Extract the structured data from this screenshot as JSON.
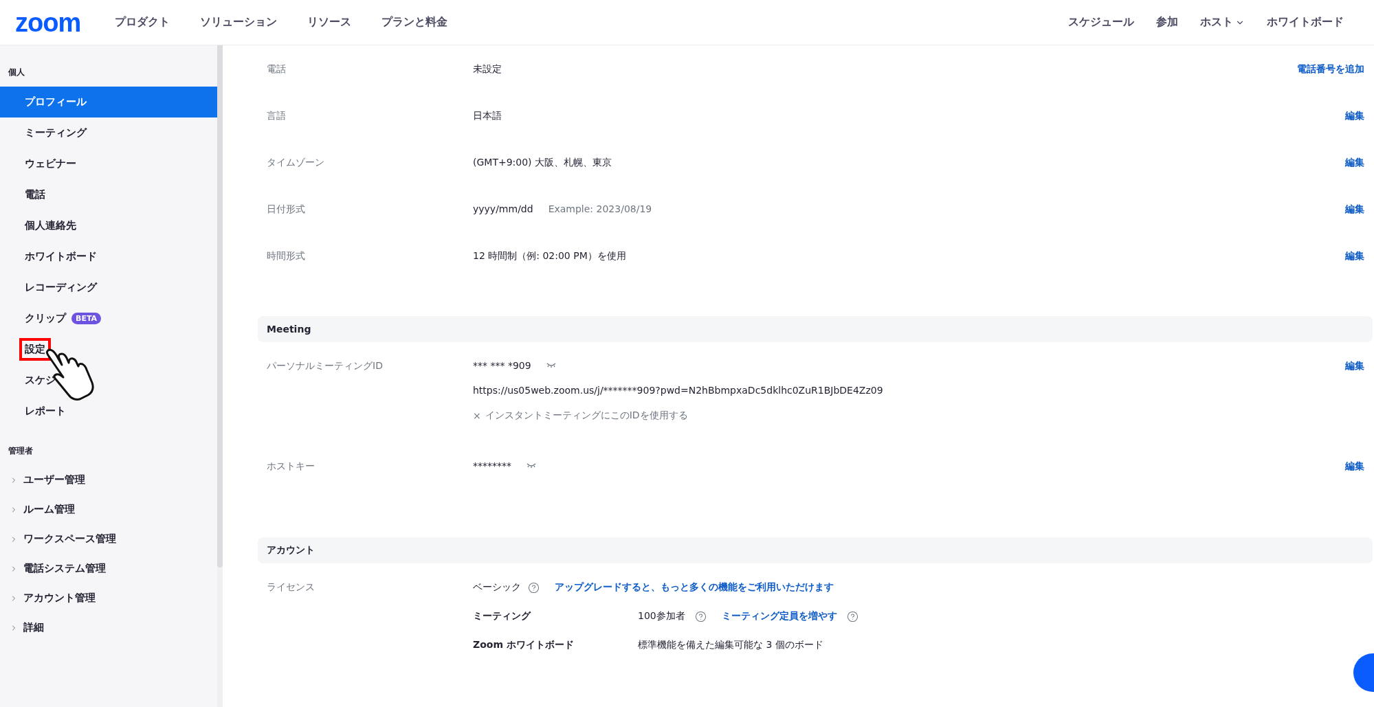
{
  "header": {
    "logo": "zoom",
    "nav_left": [
      {
        "label": "プロダクト"
      },
      {
        "label": "ソリューション"
      },
      {
        "label": "リソース"
      },
      {
        "label": "プランと料金"
      }
    ],
    "nav_right": [
      {
        "label": "スケジュール",
        "kind": "link"
      },
      {
        "label": "参加",
        "kind": "link"
      },
      {
        "label": "ホスト",
        "kind": "dropdown"
      },
      {
        "label": "ホワイトボード",
        "kind": "link"
      }
    ]
  },
  "sidebar": [
    {
      "heading": "個人",
      "items": [
        {
          "label": "プロフィール",
          "selected": true
        },
        {
          "label": "ミーティング",
          "selected": false
        },
        {
          "label": "ウェビナー",
          "selected": false
        },
        {
          "label": "電話",
          "selected": false
        },
        {
          "label": "個人連絡先",
          "selected": false
        },
        {
          "label": "ホワイトボード",
          "selected": false
        },
        {
          "label": "レコーディング",
          "selected": false
        },
        {
          "label": "クリップ",
          "selected": false,
          "badge": "BETA"
        },
        {
          "label": "設定",
          "selected": false,
          "highlighted": true
        },
        {
          "label": "スケジ",
          "selected": false
        },
        {
          "label": "レポート",
          "selected": false
        }
      ]
    },
    {
      "heading": "管理者",
      "items": [
        {
          "label": "ユーザー管理",
          "selected": false,
          "expanded": false
        },
        {
          "label": "ルーム管理",
          "selected": false,
          "expanded": false
        },
        {
          "label": "ワークスペース管理",
          "selected": false,
          "expanded": false
        },
        {
          "label": "電話システム管理",
          "selected": false,
          "expanded": false
        },
        {
          "label": "アカウント管理",
          "selected": false,
          "expanded": false
        },
        {
          "label": "詳細",
          "selected": false,
          "expanded": false
        }
      ]
    }
  ],
  "sections": [
    {
      "rows": [
        {
          "kind": "text",
          "label": "電話",
          "value": "未設定",
          "action": "電話番号を追加"
        },
        {
          "kind": "text",
          "label": "言語",
          "value": "日本語",
          "action": "編集"
        },
        {
          "kind": "text",
          "label": "タイムゾーン",
          "value": "(GMT+9:00) 大阪、札幌、東京",
          "action": "編集"
        },
        {
          "kind": "text",
          "label": "日付形式",
          "value": "yyyy/mm/dd",
          "note": "Example: 2023/08/19",
          "action": "編集"
        },
        {
          "kind": "text",
          "label": "時間形式",
          "value": "12 時間制（例: 02:00 PM）を使用",
          "action": "編集"
        }
      ]
    },
    {
      "title": "Meeting",
      "rows": [
        {
          "kind": "secret",
          "label": "パーソナルミーティングID",
          "value": "*** *** *909",
          "url": "https://us05web.zoom.us/j/*******909?pwd=N2hBbmpxaDc5dklhc0ZuR1BJbDE4Zz09",
          "option_mark": "×",
          "option": "インスタントミーティングにこのIDを使用する",
          "action": "編集"
        },
        {
          "kind": "secret",
          "label": "ホストキー",
          "value": "********",
          "action": "編集"
        }
      ]
    },
    {
      "title": "アカウント",
      "rows": [
        {
          "kind": "license",
          "label": "ライセンス",
          "value": "ベーシック",
          "link": "アップグレードすると、もっと多くの機能をご利用いただけます",
          "features": [
            {
              "name": "ミーティング",
              "value": "100参加者",
              "link": "ミーティング定員を増やす"
            },
            {
              "name": "Zoom ホワイトボード",
              "value": "標準機能を備えた編集可能な 3 個のボード"
            }
          ]
        }
      ]
    }
  ]
}
